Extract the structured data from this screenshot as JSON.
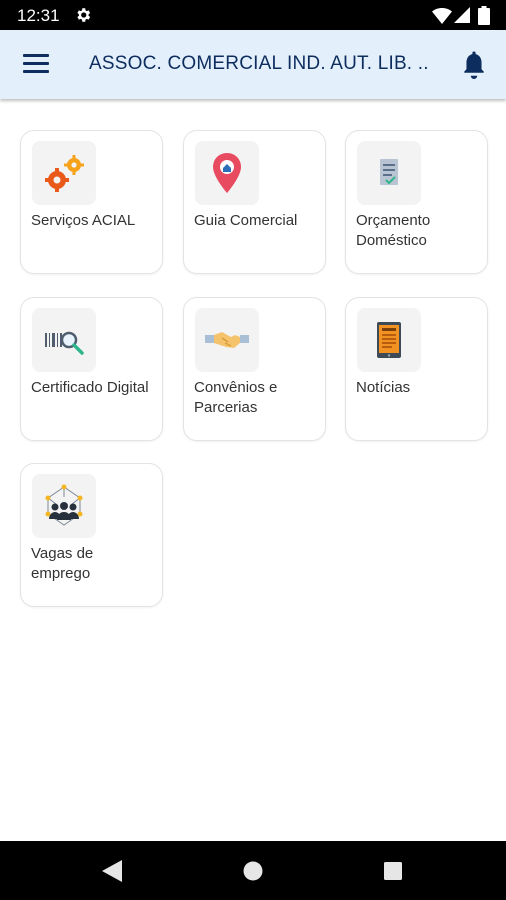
{
  "status_bar": {
    "time": "12:31",
    "icons": [
      "settings-icon",
      "wifi-icon",
      "signal-icon",
      "battery-icon"
    ]
  },
  "app_bar": {
    "title": "ASSOC. COMERCIAL IND. AUT. LIB. ...",
    "menu_icon": "menu-icon",
    "notification_icon": "bell-icon",
    "background": "#e3f0fb",
    "title_color": "#0d2d5e"
  },
  "cards": [
    {
      "label": "Serviços ACIAL",
      "icon": "gears-icon"
    },
    {
      "label": "Guia Comercial",
      "icon": "map-pin-icon"
    },
    {
      "label": "Orçamento Doméstico",
      "icon": "budget-document-icon"
    },
    {
      "label": "Certificado Digital",
      "icon": "barcode-magnifier-icon"
    },
    {
      "label": "Convênios e Parcerias",
      "icon": "handshake-icon"
    },
    {
      "label": "Notícias",
      "icon": "news-tablet-icon"
    },
    {
      "label": "Vagas de emprego",
      "icon": "team-network-icon"
    }
  ],
  "nav_bar": {
    "icons": [
      "back-icon",
      "home-icon",
      "recent-apps-icon"
    ]
  }
}
